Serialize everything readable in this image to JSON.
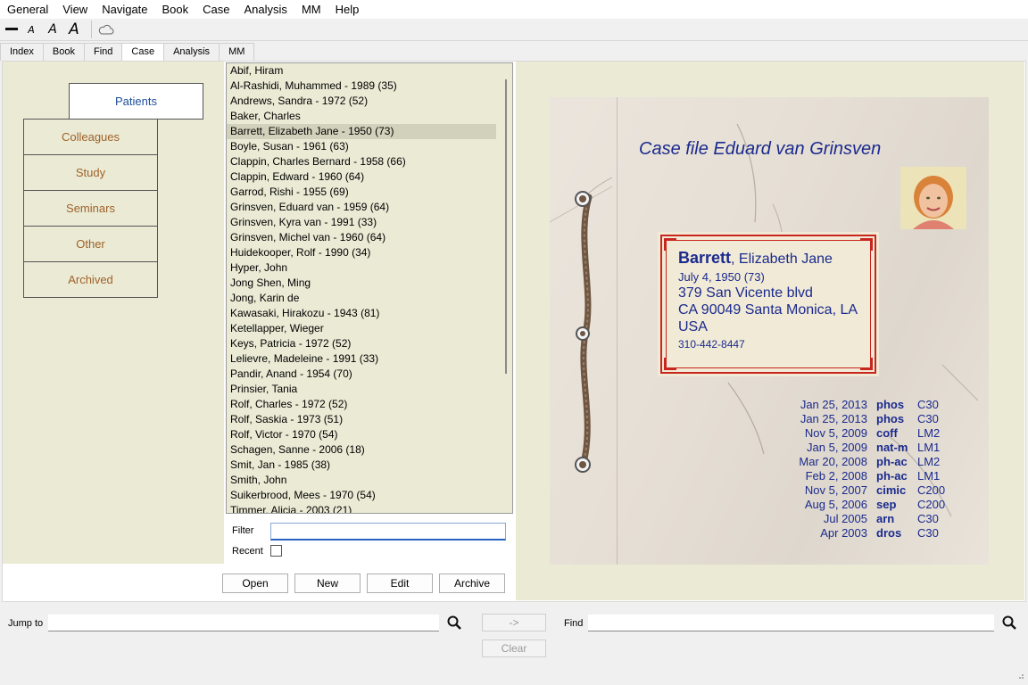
{
  "menubar": {
    "items": [
      "General",
      "View",
      "Navigate",
      "Book",
      "Case",
      "Analysis",
      "MM",
      "Help"
    ]
  },
  "toolbar": {
    "icons": [
      "minus-icon",
      "font-small-icon",
      "font-medium-icon",
      "font-large-icon",
      "cloud-icon"
    ],
    "font_glyph": "A"
  },
  "tabs": [
    "Index",
    "Book",
    "Find",
    "Case",
    "Analysis",
    "MM"
  ],
  "active_tab": "Case",
  "categories": [
    "Patients",
    "Colleagues",
    "Study",
    "Seminars",
    "Other",
    "Archived"
  ],
  "active_category": "Patients",
  "patients": [
    "Abif, Hiram",
    "Al-Rashidi, Muhammed - 1989 (35)",
    "Andrews, Sandra - 1972 (52)",
    "Baker, Charles",
    "Barrett, Elizabeth Jane - 1950 (73)",
    "Boyle, Susan - 1961 (63)",
    "Clappin, Charles Bernard - 1958 (66)",
    "Clappin, Edward - 1960 (64)",
    "Garrod, Rishi - 1955 (69)",
    "Grinsven, Eduard van - 1959 (64)",
    "Grinsven, Kyra van - 1991 (33)",
    "Grinsven, Michel van - 1960 (64)",
    "Huidekooper, Rolf - 1990 (34)",
    "Hyper, John",
    "Jong Shen, Ming",
    "Jong, Karin de",
    "Kawasaki, Hirakozu - 1943 (81)",
    "Ketellapper, Wieger",
    "Keys, Patricia - 1972 (52)",
    "Lelievre, Madeleine - 1991 (33)",
    "Pandir, Anand - 1954 (70)",
    "Prinsier, Tania",
    "Rolf, Charles - 1972 (52)",
    "Rolf, Saskia - 1973 (51)",
    "Rolf, Victor - 1970 (54)",
    "Schagen, Sanne - 2006 (18)",
    "Smit, Jan - 1985 (38)",
    "Smith, John",
    "Suikerbrood, Mees - 1970 (54)",
    "Timmer, Alicia - 2003 (21)"
  ],
  "selected_patient_index": 4,
  "filter": {
    "label": "Filter",
    "value": ""
  },
  "recent": {
    "label": "Recent",
    "checked": false
  },
  "buttons": {
    "open": "Open",
    "new": "New",
    "edit": "Edit",
    "archive": "Archive"
  },
  "casefile": {
    "title": "Case file Eduard van Grinsven",
    "last_name": "Barrett",
    "first_names": ", Elizabeth Jane",
    "birth": "July 4, 1950 (73)",
    "address1": "379 San Vicente blvd",
    "address2": "CA 90049  Santa Monica, LA",
    "country": "USA",
    "phone": "310-442-8447",
    "history": [
      {
        "date": "Jan 25, 2013",
        "remedy": "phos",
        "potency": "C30"
      },
      {
        "date": "Jan 25, 2013",
        "remedy": "phos",
        "potency": "C30"
      },
      {
        "date": "Nov 5, 2009",
        "remedy": "coff",
        "potency": "LM2"
      },
      {
        "date": "Jan 5, 2009",
        "remedy": "nat-m",
        "potency": "LM1"
      },
      {
        "date": "Mar 20, 2008",
        "remedy": "ph-ac",
        "potency": "LM2"
      },
      {
        "date": "Feb 2, 2008",
        "remedy": "ph-ac",
        "potency": "LM1"
      },
      {
        "date": "Nov 5, 2007",
        "remedy": "cimic",
        "potency": "C200"
      },
      {
        "date": "Aug 5, 2006",
        "remedy": "sep",
        "potency": "C200"
      },
      {
        "date": "Jul 2005",
        "remedy": "arn",
        "potency": "C30"
      },
      {
        "date": "Apr 2003",
        "remedy": "dros",
        "potency": "C30"
      }
    ]
  },
  "bottom": {
    "jump_label": "Jump to",
    "jump_value": "",
    "go_label": "->",
    "find_label": "Find",
    "find_value": "",
    "clear_label": "Clear"
  },
  "colors": {
    "panel_bg": "#eaead5",
    "case_text": "#1a2a8e",
    "card_border": "#c8261e",
    "category_text": "#a0622a",
    "active_category_text": "#1d4e9a"
  }
}
